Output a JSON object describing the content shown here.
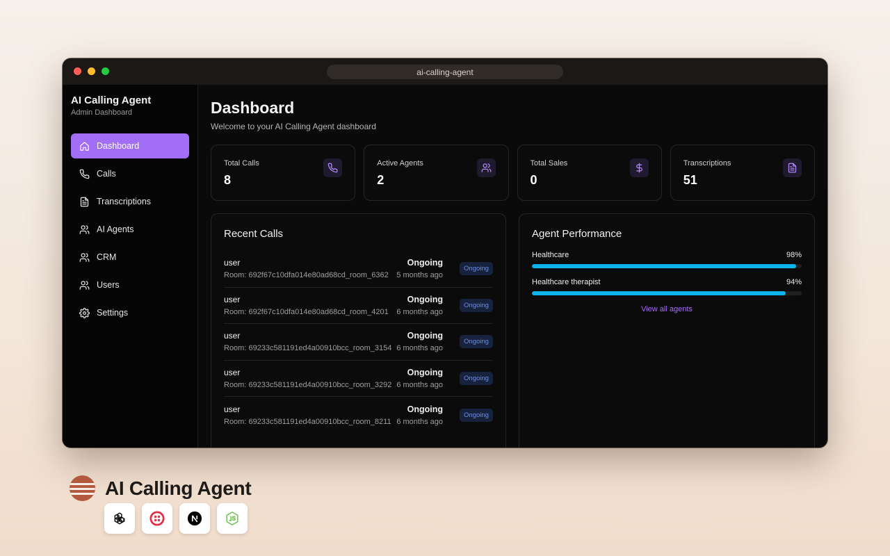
{
  "window": {
    "url": "ai-calling-agent"
  },
  "sidebar": {
    "title": "AI Calling Agent",
    "subtitle": "Admin Dashboard",
    "items": [
      {
        "label": "Dashboard",
        "icon": "home-icon",
        "active": true
      },
      {
        "label": "Calls",
        "icon": "phone-icon",
        "active": false
      },
      {
        "label": "Transcriptions",
        "icon": "document-icon",
        "active": false
      },
      {
        "label": "AI Agents",
        "icon": "users-icon",
        "active": false
      },
      {
        "label": "CRM",
        "icon": "users-icon",
        "active": false
      },
      {
        "label": "Users",
        "icon": "users-icon",
        "active": false
      },
      {
        "label": "Settings",
        "icon": "gear-icon",
        "active": false
      }
    ]
  },
  "header": {
    "title": "Dashboard",
    "subtitle": "Welcome to your AI Calling Agent dashboard"
  },
  "stats": [
    {
      "label": "Total Calls",
      "value": "8",
      "icon": "phone-icon"
    },
    {
      "label": "Active Agents",
      "value": "2",
      "icon": "users-icon"
    },
    {
      "label": "Total Sales",
      "value": "0",
      "icon": "dollar-icon"
    },
    {
      "label": "Transcriptions",
      "value": "51",
      "icon": "document-icon"
    }
  ],
  "recent_calls": {
    "title": "Recent Calls",
    "rows": [
      {
        "user": "user",
        "room": "Room: 692f67c10dfa014e80ad68cd_room_6362",
        "status": "Ongoing",
        "time": "5 months ago",
        "badge": "Ongoing"
      },
      {
        "user": "user",
        "room": "Room: 692f67c10dfa014e80ad68cd_room_4201",
        "status": "Ongoing",
        "time": "6 months ago",
        "badge": "Ongoing"
      },
      {
        "user": "user",
        "room": "Room: 69233c581191ed4a00910bcc_room_3154",
        "status": "Ongoing",
        "time": "6 months ago",
        "badge": "Ongoing"
      },
      {
        "user": "user",
        "room": "Room: 69233c581191ed4a00910bcc_room_3292",
        "status": "Ongoing",
        "time": "6 months ago",
        "badge": "Ongoing"
      },
      {
        "user": "user",
        "room": "Room: 69233c581191ed4a00910bcc_room_8211",
        "status": "Ongoing",
        "time": "6 months ago",
        "badge": "Ongoing"
      }
    ]
  },
  "agent_performance": {
    "title": "Agent Performance",
    "agents": [
      {
        "name": "Healthcare",
        "percent_label": "98%",
        "value": 98
      },
      {
        "name": "Healthcare therapist",
        "percent_label": "94%",
        "value": 94
      }
    ],
    "view_all": "View all agents"
  },
  "footer": {
    "title": "AI Calling Agent",
    "tech": [
      "openai-icon",
      "twilio-icon",
      "nextjs-icon",
      "nodejs-icon"
    ]
  },
  "colors": {
    "accent": "#a36ef6",
    "progress": "#0db4ec",
    "badge_text": "#6d8fe6",
    "badge_bg": "#17223f"
  }
}
